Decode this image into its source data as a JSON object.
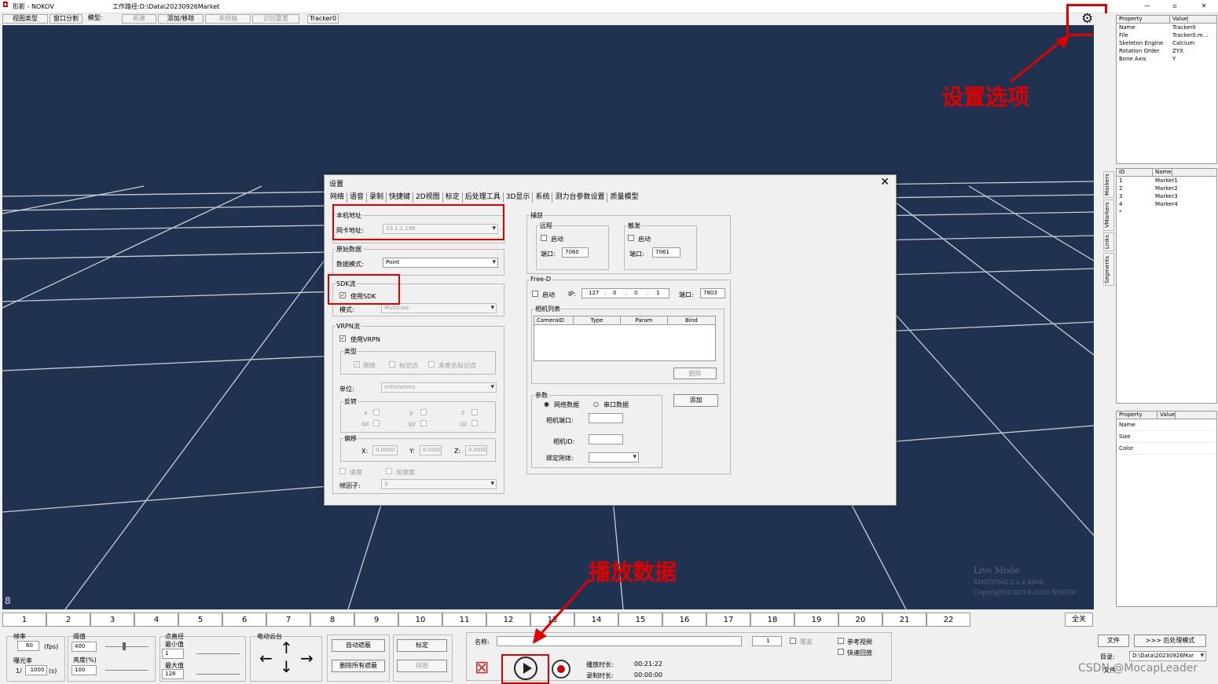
{
  "window": {
    "title": "形影 - NOKOV",
    "workpath": "工作路径:D:\\Data\\20230926Market",
    "min": "—",
    "max": "▫",
    "close": "✕"
  },
  "menubar": {
    "view_type": "视图类型",
    "window_split": "窗口分割",
    "model": "模型:",
    "new": "新建",
    "add_remove": "添加/移除",
    "unbind": "未结轴",
    "recog": "识别重置",
    "tracker": "Tracker0"
  },
  "prop_top": {
    "headers": [
      "Property",
      "Value"
    ],
    "rows": [
      [
        "Name",
        "Tracker0"
      ],
      [
        "File",
        "Tracker0.m..."
      ],
      [
        "Skeleton Engine",
        "Calcium"
      ],
      [
        "Rotation Order",
        "ZYX"
      ],
      [
        "Bone Axis",
        "Y"
      ]
    ]
  },
  "vtabs": [
    "Markers",
    "VMarkers",
    "Links",
    "Segments"
  ],
  "markers": {
    "headers": [
      "ID",
      "Name"
    ],
    "rows": [
      [
        "1",
        "Marker1"
      ],
      [
        "2",
        "Marker2"
      ],
      [
        "3",
        "Marker3"
      ],
      [
        "4",
        "Marker4"
      ],
      [
        "*",
        ""
      ]
    ]
  },
  "prop_bottom": {
    "headers": [
      "Property",
      "Value"
    ],
    "rows": [
      "Name",
      "Size",
      "Color"
    ]
  },
  "annotations": {
    "settings": "设置选项",
    "play": "播放数据"
  },
  "viewport": {
    "corner_num": "8",
    "wm1": "Live Mode",
    "wm2": "XINGYING 2.x.x.4908",
    "wm3": "Copyright(C)2019-2023 NOKOV"
  },
  "dialog": {
    "title": "设置",
    "close": "✕",
    "tabs": [
      "网络",
      "语音",
      "录制",
      "快捷键",
      "2D视图",
      "标定",
      "后处理工具",
      "3D显示",
      "系统",
      "测力台参数设置",
      "质量模型"
    ],
    "local": {
      "group": "本机地址",
      "label": "网卡地址:",
      "value": "10.1.1.198"
    },
    "raw": {
      "group": "原始数据",
      "label": "数据模式:",
      "value": "Point"
    },
    "sdk": {
      "group": "SDK流",
      "use": "使用SDK",
      "mode_label": "模式:",
      "mode": "Multicast"
    },
    "vrpn": {
      "group": "VRPN流",
      "use": "使用VRPN",
      "type": "类型",
      "rigid": "刚体",
      "marker": "标记点",
      "unnamed": "未命名标记点",
      "unit_label": "单位:",
      "unit": "millimeters",
      "flip": "反转",
      "x": "x",
      "y": "y",
      "z": "z",
      "qx": "qx",
      "qy": "qy",
      "qz": "qz",
      "offset": "偏移",
      "ox": "X:",
      "oy": "Y:",
      "oz": "Z:",
      "ov": "0.0000",
      "speed": "速度",
      "accel": "加速度",
      "frame_factor": "帧因子:",
      "ff": "3"
    },
    "capture": {
      "group": "捕获",
      "remote": "远程",
      "trigger": "触发",
      "enable": "启动",
      "port": "端口:",
      "p1": "7060",
      "p2": "7061"
    },
    "freed": {
      "group": "Free-D",
      "enable": "启动",
      "ip": "IP:",
      "ip1": "127",
      "ip2": "0",
      "ip3": "0",
      "ip4": "1",
      "port": "端口:",
      "pv": "7803",
      "camlist": "相机列表",
      "cols": [
        "CameraID",
        "Type",
        "Param",
        "Bind"
      ],
      "delete": "删除"
    },
    "params": {
      "group": "参数",
      "net": "网络数据",
      "serial": "串口数据",
      "camport": "相机端口:",
      "camid": "相机ID:",
      "bind": "绑定刚体:",
      "add": "添加"
    }
  },
  "timeline": [
    "1",
    "2",
    "3",
    "4",
    "5",
    "6",
    "7",
    "8",
    "9",
    "10",
    "11",
    "12",
    "13",
    "14",
    "15",
    "16",
    "17",
    "18",
    "19",
    "20",
    "21",
    "22"
  ],
  "timeline_all": "全关",
  "controls": {
    "fps_label": "帧率",
    "fps": "60",
    "fps_unit": "(fps)",
    "exposure": "曝光率",
    "exp_pre": "1/",
    "exp": "1000",
    "exp_unit": "(s)",
    "threshold": "阈值",
    "thr": "400",
    "bright": "亮度(%)",
    "bri": "100",
    "dot": "点直径",
    "min": "最小值",
    "minv": "1",
    "max": "最大值",
    "maxv": "128",
    "ptz": "电动云台",
    "auto_mask": "自动遮蔽",
    "del_mask": "删除所有遮蔽",
    "calib": "标定",
    "sort": "排图",
    "name_label": "名称:",
    "frame": "1",
    "overwrite": "覆盖",
    "ref_video": "参考视频",
    "fast_play": "快速回放",
    "play_time_label": "播放时长:",
    "play_time": "00:21:22",
    "rec_time_label": "录制时长:",
    "rec_time": "00:00:00",
    "file": "文件",
    "post": ">>> 后处理模式",
    "dir_label": "目录:",
    "dir": "D:\\Data\\20230926Mar",
    "footer_a": "文件",
    "footer_b": "CSDN @MocapLeader"
  },
  "colors": {
    "viewport": "#1f3350",
    "annotation": "#e00000"
  }
}
